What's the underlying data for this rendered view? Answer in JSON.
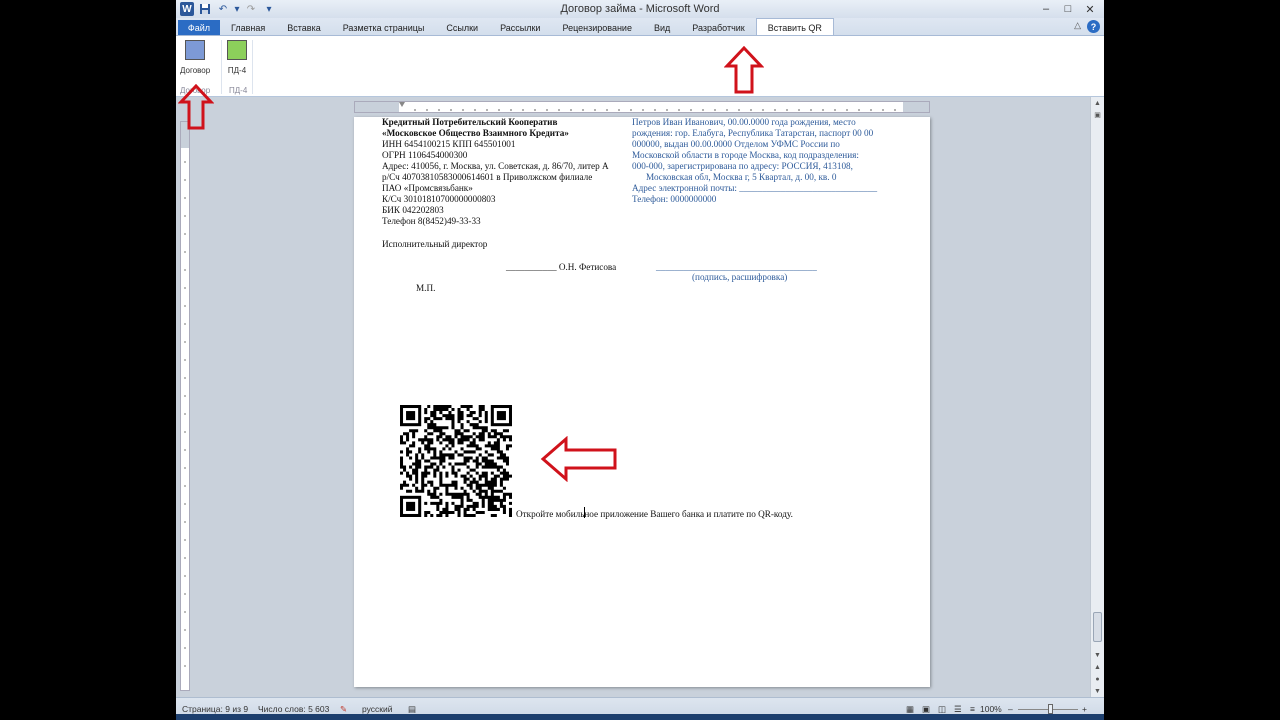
{
  "window": {
    "title": "Договор займа - Microsoft Word",
    "controls": [
      "–",
      "□",
      "✕"
    ]
  },
  "qat": {
    "logo": "W",
    "undo": "↶",
    "undo_drop": "▾",
    "redo": "↷",
    "more": "▾"
  },
  "tabs": [
    {
      "label": "Файл"
    },
    {
      "label": "Главная"
    },
    {
      "label": "Вставка"
    },
    {
      "label": "Разметка страницы"
    },
    {
      "label": "Ссылки"
    },
    {
      "label": "Рассылки"
    },
    {
      "label": "Рецензирование"
    },
    {
      "label": "Вид"
    },
    {
      "label": "Разработчик"
    },
    {
      "label": "Вставить QR"
    }
  ],
  "tabs_right": {
    "minimize": "△",
    "help": "?"
  },
  "ribbon": {
    "buttons": [
      {
        "label": "Договор",
        "color": "#7d9ad6"
      },
      {
        "label": "ПД-4",
        "color": "#8ccf5b"
      }
    ],
    "groups": [
      "Договор",
      "ПД-4"
    ]
  },
  "document": {
    "left_column": [
      "Кредитный Потребительский Кооператив",
      "«Московское Общество Взаимного Кредита»",
      "ИНН  6454100215 КПП 645501001",
      "ОГРН 1106454000300",
      "Адрес: 410056, г. Москва, ул. Советская, д. 86/70, литер А",
      "р/Сч  40703810583000614601 в Приволжском филиале",
      "ПАО «Промсвязьбанк»",
      "К/Сч  30101810700000000803",
      "БИК 042202803",
      "Телефон 8(8452)49-33-33"
    ],
    "right_column": [
      "Петров Иван Иванович, 00.00.0000 года рождения, место",
      "рождения: гор. Елабуга, Республика Татарстан, паспорт 00 00",
      "000000, выдан 00.00.0000 Отделом УФМС России по",
      "Московской области в городе Москва, код подразделения:",
      "000-000, зарегистрирована по адресу: РОССИЯ, 413108,",
      "Московская обл, Москва г, 5 Квартал, д. 00, кв. 0",
      "Адрес электронной почты: ______________________________",
      "Телефон: 0000000000"
    ],
    "director": "Исполнительный директор",
    "sign_line": "___________ О.Н. Фетисова",
    "client_sign_line": "___________________________________",
    "client_sign_caption": "(подпись, расшифровка)",
    "stamp": "М.П.",
    "qr_caption": "Откройте мобильное приложение Вашего банка и платите по QR-коду."
  },
  "status": {
    "page": "Страница: 9 из 9",
    "words": "Число слов: 5 603",
    "language": "русский",
    "zoom": "100%",
    "zoom_minus": "–",
    "zoom_plus": "+"
  },
  "colors": {
    "annotation_arrow": "#d0121b",
    "accent": "#2b579a",
    "client_text": "#2e5b9a"
  }
}
